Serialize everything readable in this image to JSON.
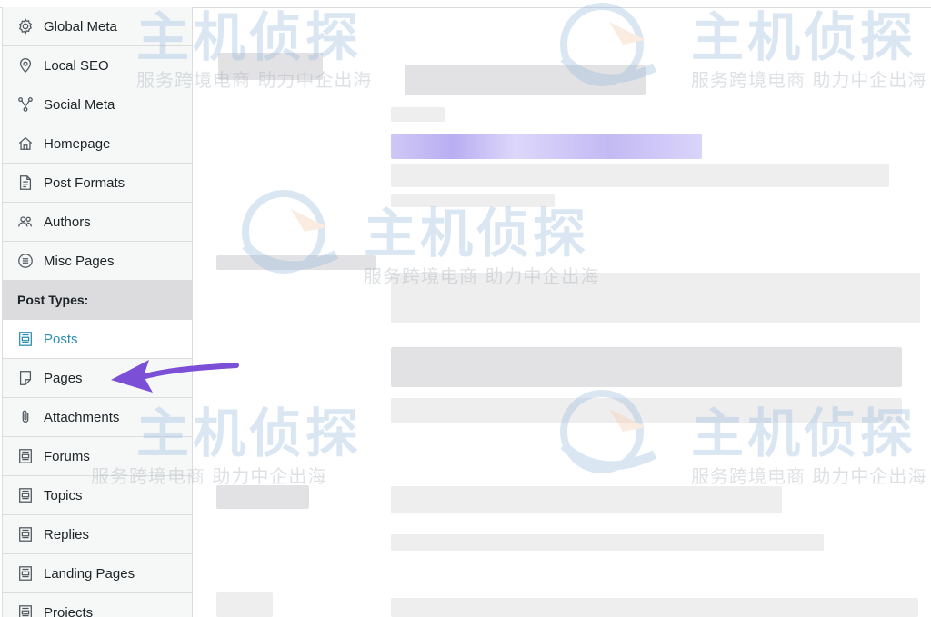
{
  "sidebar": {
    "items": [
      {
        "label": "Global Meta",
        "icon": "gear-icon"
      },
      {
        "label": "Local SEO",
        "icon": "location-pin-icon"
      },
      {
        "label": "Social Meta",
        "icon": "share-icon"
      },
      {
        "label": "Homepage",
        "icon": "home-icon"
      },
      {
        "label": "Post Formats",
        "icon": "document-icon"
      },
      {
        "label": "Authors",
        "icon": "users-icon"
      },
      {
        "label": "Misc Pages",
        "icon": "list-circle-icon"
      }
    ],
    "section_header": "Post Types:",
    "post_types": [
      {
        "label": "Posts",
        "icon": "post-icon",
        "active": true
      },
      {
        "label": "Pages",
        "icon": "page-icon"
      },
      {
        "label": "Attachments",
        "icon": "paperclip-icon"
      },
      {
        "label": "Forums",
        "icon": "post-icon"
      },
      {
        "label": "Topics",
        "icon": "post-icon"
      },
      {
        "label": "Replies",
        "icon": "post-icon"
      },
      {
        "label": "Landing Pages",
        "icon": "post-icon"
      },
      {
        "label": "Projects",
        "icon": "post-icon"
      }
    ]
  },
  "watermark": {
    "brand": "主机侦探",
    "tagline": "服务跨境电商 助力中企出海",
    "color": "#8fb6dc"
  },
  "colors": {
    "active_text": "#2a8dad",
    "arrow": "#7b4fd6"
  }
}
